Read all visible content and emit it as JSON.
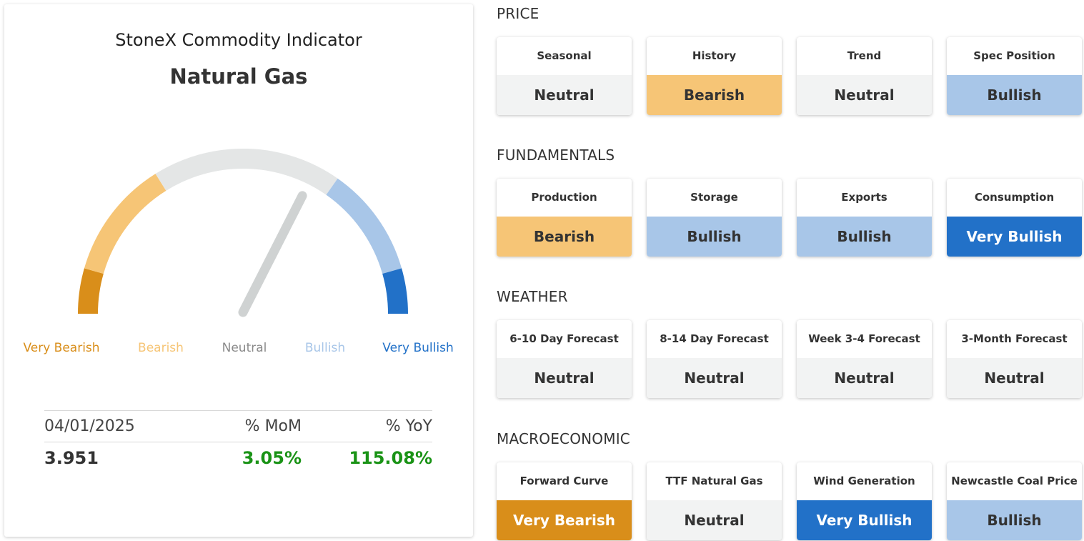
{
  "indicator": {
    "app_title": "StoneX Commodity Indicator",
    "commodity": "Natural Gas"
  },
  "gauge": {
    "labels": [
      "Very Bearish",
      "Bearish",
      "Neutral",
      "Bullish",
      "Very Bullish"
    ],
    "colors": [
      "#d98e1a",
      "#f6c576",
      "#8a8a8a",
      "#a8c6e8",
      "#2271c8"
    ],
    "arc_colors": [
      "#d98e1a",
      "#f6c576",
      "#e4e6e6",
      "#a8c6e8",
      "#2271c8"
    ],
    "needle_reading": 0.65
  },
  "stats": {
    "date": "04/01/2025",
    "mom_label": "% MoM",
    "yoy_label": "% YoY",
    "price": "3.951",
    "mom": "3.05%",
    "yoy": "115.08%",
    "positive_color": "#1a9316"
  },
  "sections": [
    {
      "title": "PRICE",
      "cards": [
        {
          "label": "Seasonal",
          "value": "Neutral"
        },
        {
          "label": "History",
          "value": "Bearish"
        },
        {
          "label": "Trend",
          "value": "Neutral"
        },
        {
          "label": "Spec Position",
          "value": "Bullish"
        }
      ]
    },
    {
      "title": "FUNDAMENTALS",
      "cards": [
        {
          "label": "Production",
          "value": "Bearish"
        },
        {
          "label": "Storage",
          "value": "Bullish"
        },
        {
          "label": "Exports",
          "value": "Bullish"
        },
        {
          "label": "Consumption",
          "value": "Very Bullish"
        }
      ]
    },
    {
      "title": "WEATHER",
      "cards": [
        {
          "label": "6-10 Day Forecast",
          "value": "Neutral"
        },
        {
          "label": "8-14 Day Forecast",
          "value": "Neutral"
        },
        {
          "label": "Week 3-4 Forecast",
          "value": "Neutral"
        },
        {
          "label": "3-Month Forecast",
          "value": "Neutral"
        }
      ]
    },
    {
      "title": "MACROECONOMIC",
      "cards": [
        {
          "label": "Forward Curve",
          "value": "Very Bearish"
        },
        {
          "label": "TTF Natural Gas",
          "value": "Neutral"
        },
        {
          "label": "Wind Generation",
          "value": "Very Bullish"
        },
        {
          "label": "Newcastle Coal Price",
          "value": "Bullish"
        }
      ]
    }
  ]
}
